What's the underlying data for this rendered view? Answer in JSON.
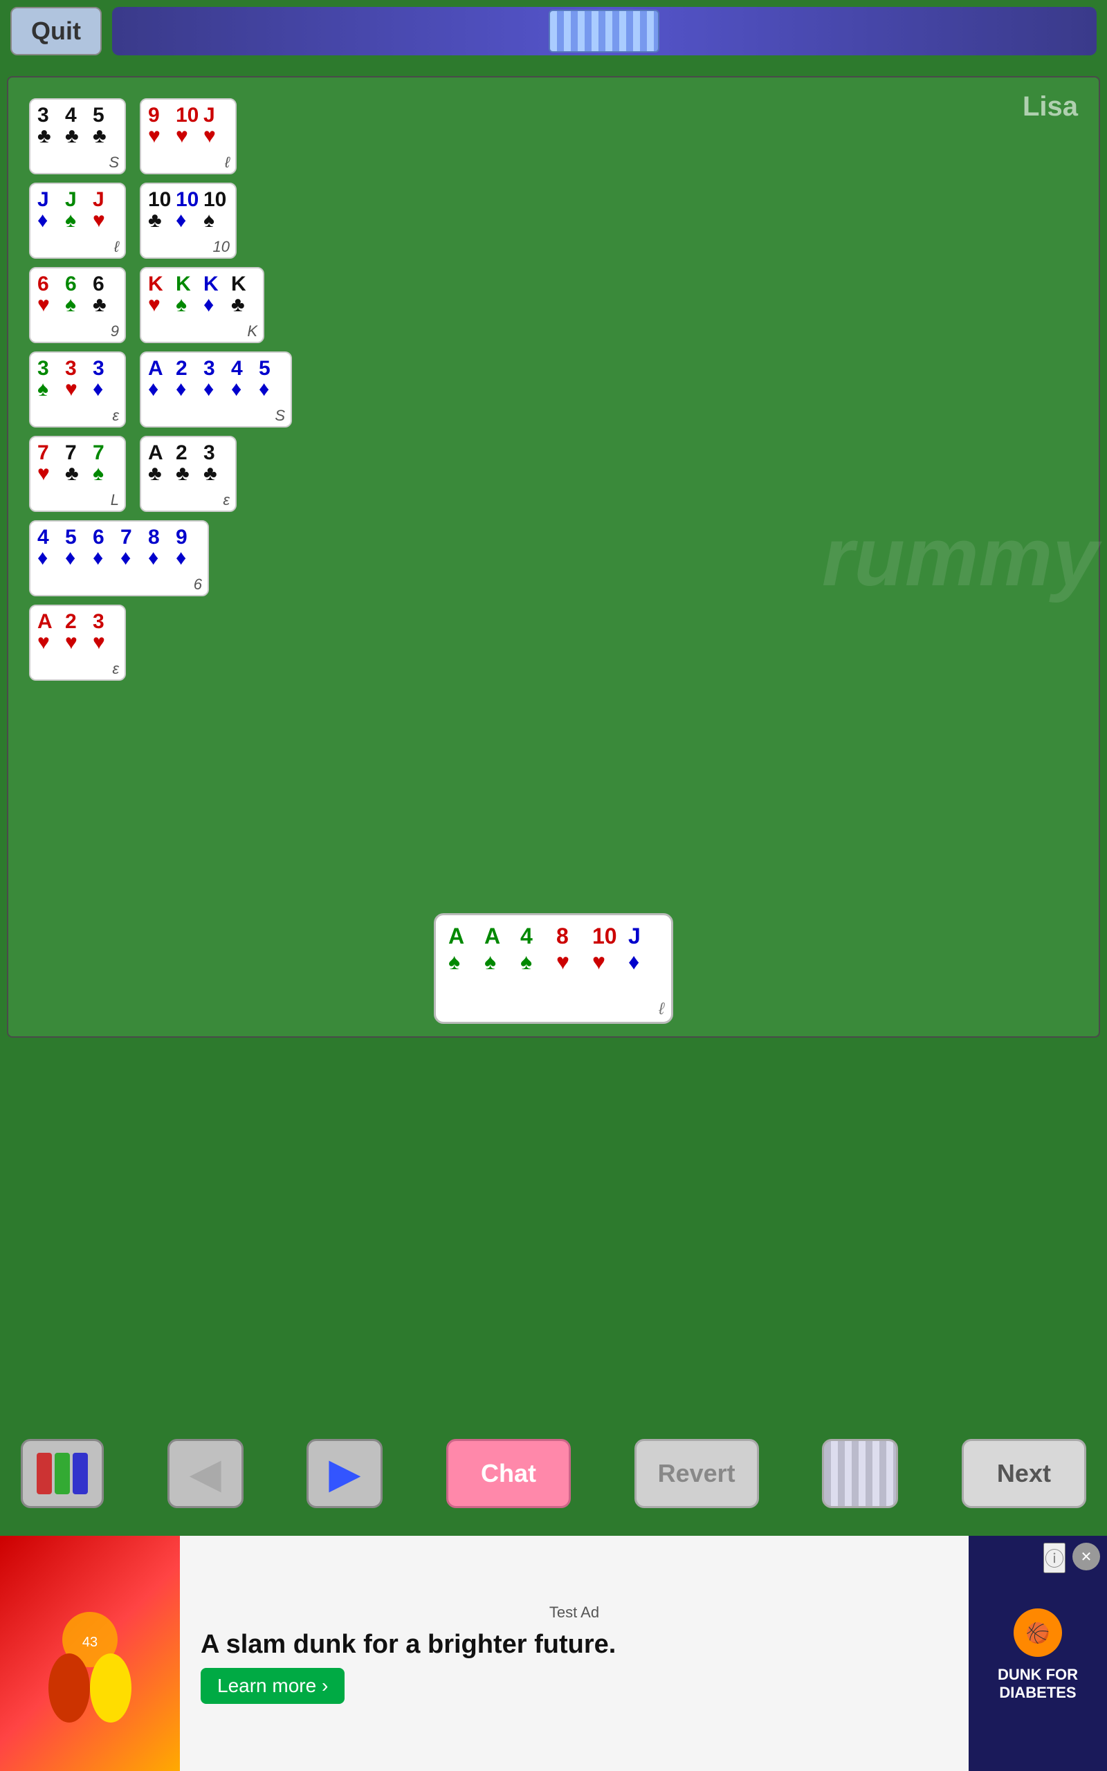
{
  "topBar": {
    "quitLabel": "Quit",
    "deckLabel": "deck"
  },
  "playerName": "Lisa",
  "watermark": "rummy",
  "cardGroups": [
    {
      "id": "group1",
      "cards": [
        {
          "rank": "3",
          "suit": "♣",
          "color": "black"
        },
        {
          "rank": "4",
          "suit": "♣",
          "color": "black"
        },
        {
          "rank": "5",
          "suit": "♣",
          "color": "black"
        }
      ],
      "count": "S"
    },
    {
      "id": "group2",
      "cards": [
        {
          "rank": "9",
          "suit": "♥",
          "color": "red"
        },
        {
          "rank": "10",
          "suit": "♥",
          "color": "red"
        },
        {
          "rank": "J",
          "suit": "♥",
          "color": "red"
        }
      ],
      "count": "ℓ"
    },
    {
      "id": "group3",
      "cards": [
        {
          "rank": "J",
          "suit": "♦",
          "color": "blue"
        },
        {
          "rank": "J",
          "suit": "♠",
          "color": "green"
        },
        {
          "rank": "J",
          "suit": "♥",
          "color": "red"
        }
      ],
      "count": "ℓ"
    },
    {
      "id": "group4",
      "cards": [
        {
          "rank": "10",
          "suit": "♣",
          "color": "black"
        },
        {
          "rank": "10",
          "suit": "♦",
          "color": "blue"
        },
        {
          "rank": "10",
          "suit": "♠",
          "color": "black"
        }
      ],
      "count": "10"
    },
    {
      "id": "group5",
      "cards": [
        {
          "rank": "6",
          "suit": "♥",
          "color": "red"
        },
        {
          "rank": "6",
          "suit": "♠",
          "color": "green"
        },
        {
          "rank": "6",
          "suit": "♣",
          "color": "black"
        }
      ],
      "count": "9"
    },
    {
      "id": "group6",
      "cards": [
        {
          "rank": "K",
          "suit": "♥",
          "color": "red"
        },
        {
          "rank": "K",
          "suit": "♠",
          "color": "green"
        },
        {
          "rank": "K",
          "suit": "♦",
          "color": "blue"
        },
        {
          "rank": "K",
          "suit": "♣",
          "color": "black"
        }
      ],
      "count": "K"
    },
    {
      "id": "group7",
      "cards": [
        {
          "rank": "3",
          "suit": "♠",
          "color": "green"
        },
        {
          "rank": "3",
          "suit": "♥",
          "color": "red"
        },
        {
          "rank": "3",
          "suit": "♦",
          "color": "blue"
        }
      ],
      "count": "ε"
    },
    {
      "id": "group8",
      "cards": [
        {
          "rank": "A",
          "suit": "♦",
          "color": "blue"
        },
        {
          "rank": "2",
          "suit": "♦",
          "color": "blue"
        },
        {
          "rank": "3",
          "suit": "♦",
          "color": "blue"
        },
        {
          "rank": "4",
          "suit": "♦",
          "color": "blue"
        },
        {
          "rank": "5",
          "suit": "♦",
          "color": "blue"
        }
      ],
      "count": "S"
    },
    {
      "id": "group9",
      "cards": [
        {
          "rank": "7",
          "suit": "♥",
          "color": "red"
        },
        {
          "rank": "7",
          "suit": "♣",
          "color": "black"
        },
        {
          "rank": "7",
          "suit": "♠",
          "color": "green"
        }
      ],
      "count": "L"
    },
    {
      "id": "group10",
      "cards": [
        {
          "rank": "A",
          "suit": "♣",
          "color": "black"
        },
        {
          "rank": "2",
          "suit": "♣",
          "color": "black"
        },
        {
          "rank": "3",
          "suit": "♣",
          "color": "black"
        }
      ],
      "count": "ε"
    },
    {
      "id": "group11",
      "cards": [
        {
          "rank": "4",
          "suit": "♦",
          "color": "blue"
        },
        {
          "rank": "5",
          "suit": "♦",
          "color": "blue"
        },
        {
          "rank": "6",
          "suit": "♦",
          "color": "blue"
        },
        {
          "rank": "7",
          "suit": "♦",
          "color": "blue"
        },
        {
          "rank": "8",
          "suit": "♦",
          "color": "blue"
        },
        {
          "rank": "9",
          "suit": "♦",
          "color": "blue"
        }
      ],
      "count": "6"
    },
    {
      "id": "group12",
      "cards": [
        {
          "rank": "A",
          "suit": "♥",
          "color": "red"
        },
        {
          "rank": "2",
          "suit": "♥",
          "color": "red"
        },
        {
          "rank": "3",
          "suit": "♥",
          "color": "red"
        }
      ],
      "count": "ε"
    }
  ],
  "handCards": [
    {
      "rank": "A",
      "suit": "♠",
      "color": "green"
    },
    {
      "rank": "A",
      "suit": "♠",
      "color": "green"
    },
    {
      "rank": "4",
      "suit": "♠",
      "color": "green"
    },
    {
      "rank": "8",
      "suit": "♥",
      "color": "red"
    },
    {
      "rank": "10",
      "suit": "♥",
      "color": "red"
    },
    {
      "rank": "J",
      "suit": "♦",
      "color": "blue"
    }
  ],
  "handCount": "ℓ",
  "controls": {
    "chatLabel": "Chat",
    "revertLabel": "Revert",
    "nextLabel": "Next"
  },
  "ad": {
    "testLabel": "Test Ad",
    "title": "A slam dunk for a brighter future.",
    "ctaLabel": "Learn more ›",
    "logoText": "DUNK FOR DIABETES"
  }
}
